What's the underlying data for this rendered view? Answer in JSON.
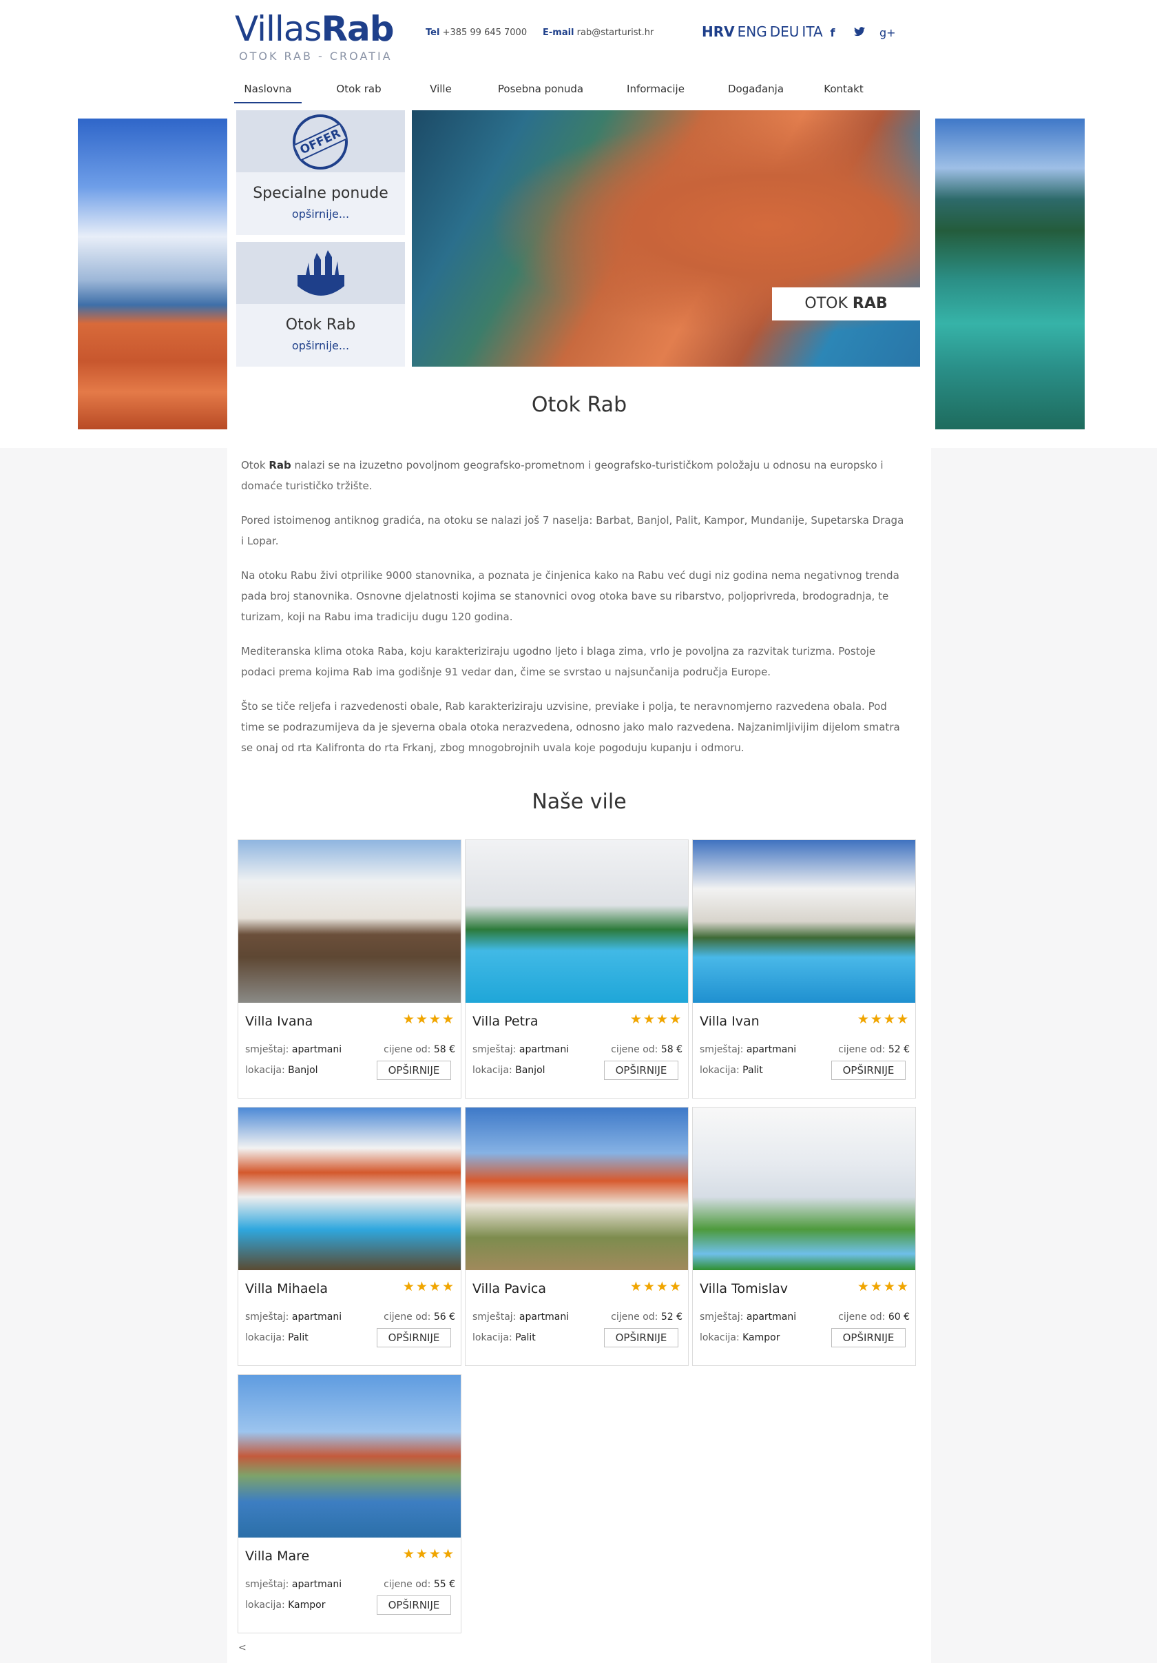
{
  "logo": {
    "part1": "Villas",
    "part2": "Rab",
    "tagline": "OTOK RAB - CROATIA"
  },
  "contact": {
    "tel_label": "Tel",
    "tel_value": "+385 99 645 7000",
    "mail_label": "E-mail",
    "mail_value": "rab@starturist.hr"
  },
  "languages": [
    "HRV",
    "ENG",
    "DEU",
    "ITA"
  ],
  "social": {
    "facebook": "f",
    "twitter": "t",
    "googleplus": "g+"
  },
  "nav": [
    "Naslovna",
    "Otok rab",
    "Ville",
    "Posebna ponuda",
    "Informacije",
    "Događanja",
    "Kontakt"
  ],
  "promos": [
    {
      "badge": "OFFER",
      "title": "Specialne ponude",
      "more": "opširnije..."
    },
    {
      "title": "Otok Rab",
      "more": "opširnije..."
    }
  ],
  "hero": {
    "caption_light": "OTOK ",
    "caption_bold": "RAB"
  },
  "intro_title": "Otok Rab",
  "paragraphs": {
    "p1_a": "Otok ",
    "p1_b": "Rab",
    "p1_c": " nalazi se na izuzetno povoljnom geografsko-prometnom i geografsko-turističkom položaju u odnosu na europsko i domaće turističko tržište.",
    "p2": "Pored istoimenog antiknog gradića, na otoku se nalazi još 7 naselja: Barbat, Banjol, Palit, Kampor, Mundanije, Supetarska Draga i Lopar.",
    "p3": "Na otoku Rabu živi otprilike 9000 stanovnika, a poznata je činjenica kako na Rabu već dugi niz godina nema negativnog trenda pada broj stanovnika. Osnovne djelatnosti kojima se stanovnici ovog otoka bave su ribarstvo, poljoprivreda, brodogradnja, te turizam, koji na Rabu ima tradiciju dugu 120 godina.",
    "p4": "Mediteranska klima otoka Raba, koju karakteriziraju ugodno ljeto i blaga zima, vrlo je povoljna za razvitak turizma. Postoje podaci prema kojima Rab ima godišnje 91 vedar dan, čime se svrstao u najsunčanija područja Europe.",
    "p5": "Što se tiče reljefa i razvedenosti obale, Rab karakteriziraju uzvisine, previake i polja, te neravnomjerno razvedena obala. Pod time se podrazumijeva da je sjeverna obala otoka nerazvedena, odnosno jako malo razvedena. Najzanimljivijim dijelom smatra se onaj od rta Kalifronta do rta Frkanj, zbog mnogobrojnih uvala koje pogoduju kupanju i odmoru."
  },
  "villas_title": "Naše vile",
  "labels": {
    "smjestaj": "smještaj: ",
    "lokacija": "lokacija: ",
    "cijene": "cijene od: ",
    "more": "OPŠIRNIJE",
    "stars": "★★★★"
  },
  "villas": [
    {
      "name": "Villa Ivana",
      "type": "apartmani",
      "price": "58 €",
      "location": "Banjol"
    },
    {
      "name": "Villa Petra",
      "type": "apartmani",
      "price": "58 €",
      "location": "Banjol"
    },
    {
      "name": "Villa Ivan",
      "type": "apartmani",
      "price": "52 €",
      "location": "Palit"
    },
    {
      "name": "Villa Mihaela",
      "type": "apartmani",
      "price": "56 €",
      "location": "Palit"
    },
    {
      "name": "Villa Pavica",
      "type": "apartmani",
      "price": "52 €",
      "location": "Palit"
    },
    {
      "name": "Villa Tomislav",
      "type": "apartmani",
      "price": "60 €",
      "location": "Kampor"
    },
    {
      "name": "Villa Mare",
      "type": "apartmani",
      "price": "55 €",
      "location": "Kampor"
    }
  ],
  "pager": "<"
}
